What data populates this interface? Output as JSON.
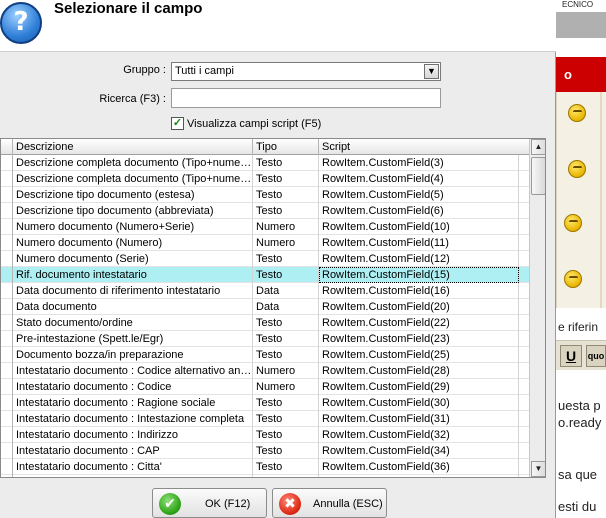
{
  "background_page": {
    "top_strip_text": "ECNICO",
    "red_bar_text": "o",
    "riferim_text": "e riferin",
    "toolbar": {
      "u_button": "U",
      "q_button": "quo"
    },
    "text_lines": [
      "uesta p",
      "o.ready",
      "sa que",
      "esti du"
    ],
    "emoticons": [
      "emoticon-1",
      "emoticon-2",
      "emoticon-3",
      "emoticon-4"
    ]
  },
  "dialog": {
    "title": "Selezionare il campo",
    "help_icon": "?",
    "gruppo_label": "Gruppo :",
    "gruppo_value": "Tutti i campi",
    "ricerca_label": "Ricerca (F3) :",
    "ricerca_value": "",
    "script_checkbox_label": "Visualizza campi script (F5)",
    "script_checkbox_checked": true,
    "columns": [
      "Descrizione",
      "Tipo",
      "Script"
    ],
    "selected_row_index": 7,
    "rows": [
      [
        "Descrizione completa documento (Tipo+numero+serie)",
        "Testo",
        "RowItem.CustomField(3)"
      ],
      [
        "Descrizione completa documento (Tipo+numero)",
        "Testo",
        "RowItem.CustomField(4)"
      ],
      [
        "Descrizione tipo documento (estesa)",
        "Testo",
        "RowItem.CustomField(5)"
      ],
      [
        "Descrizione tipo documento (abbreviata)",
        "Testo",
        "RowItem.CustomField(6)"
      ],
      [
        "Numero documento (Numero+Serie)",
        "Numero",
        "RowItem.CustomField(10)"
      ],
      [
        "Numero documento (Numero)",
        "Numero",
        "RowItem.CustomField(11)"
      ],
      [
        "Numero documento (Serie)",
        "Testo",
        "RowItem.CustomField(12)"
      ],
      [
        "Rif. documento intestatario",
        "Testo",
        "RowItem.CustomField(15)"
      ],
      [
        "Data documento di riferimento intestatario",
        "Data",
        "RowItem.CustomField(16)"
      ],
      [
        "Data documento",
        "Data",
        "RowItem.CustomField(20)"
      ],
      [
        "Stato documento/ordine",
        "Testo",
        "RowItem.CustomField(22)"
      ],
      [
        "Pre-intestazione (Spett.le/Egr)",
        "Testo",
        "RowItem.CustomField(23)"
      ],
      [
        "Documento bozza/in preparazione",
        "Testo",
        "RowItem.CustomField(25)"
      ],
      [
        "Intestatario documento : Codice alternativo anagrafica",
        "Numero",
        "RowItem.CustomField(28)"
      ],
      [
        "Intestatario documento : Codice",
        "Numero",
        "RowItem.CustomField(29)"
      ],
      [
        "Intestatario documento : Ragione sociale",
        "Testo",
        "RowItem.CustomField(30)"
      ],
      [
        "Intestatario documento : Intestazione completa",
        "Testo",
        "RowItem.CustomField(31)"
      ],
      [
        "Intestatario documento : Indirizzo",
        "Testo",
        "RowItem.CustomField(32)"
      ],
      [
        "Intestatario documento : CAP",
        "Testo",
        "RowItem.CustomField(34)"
      ],
      [
        "Intestatario documento : Citta'",
        "Testo",
        "RowItem.CustomField(36)"
      ],
      [
        "",
        "",
        ""
      ]
    ],
    "ok_button": "OK (F12)",
    "cancel_button": "Annulla (ESC)",
    "scroll_up_glyph": "▲",
    "scroll_down_glyph": "▼"
  }
}
